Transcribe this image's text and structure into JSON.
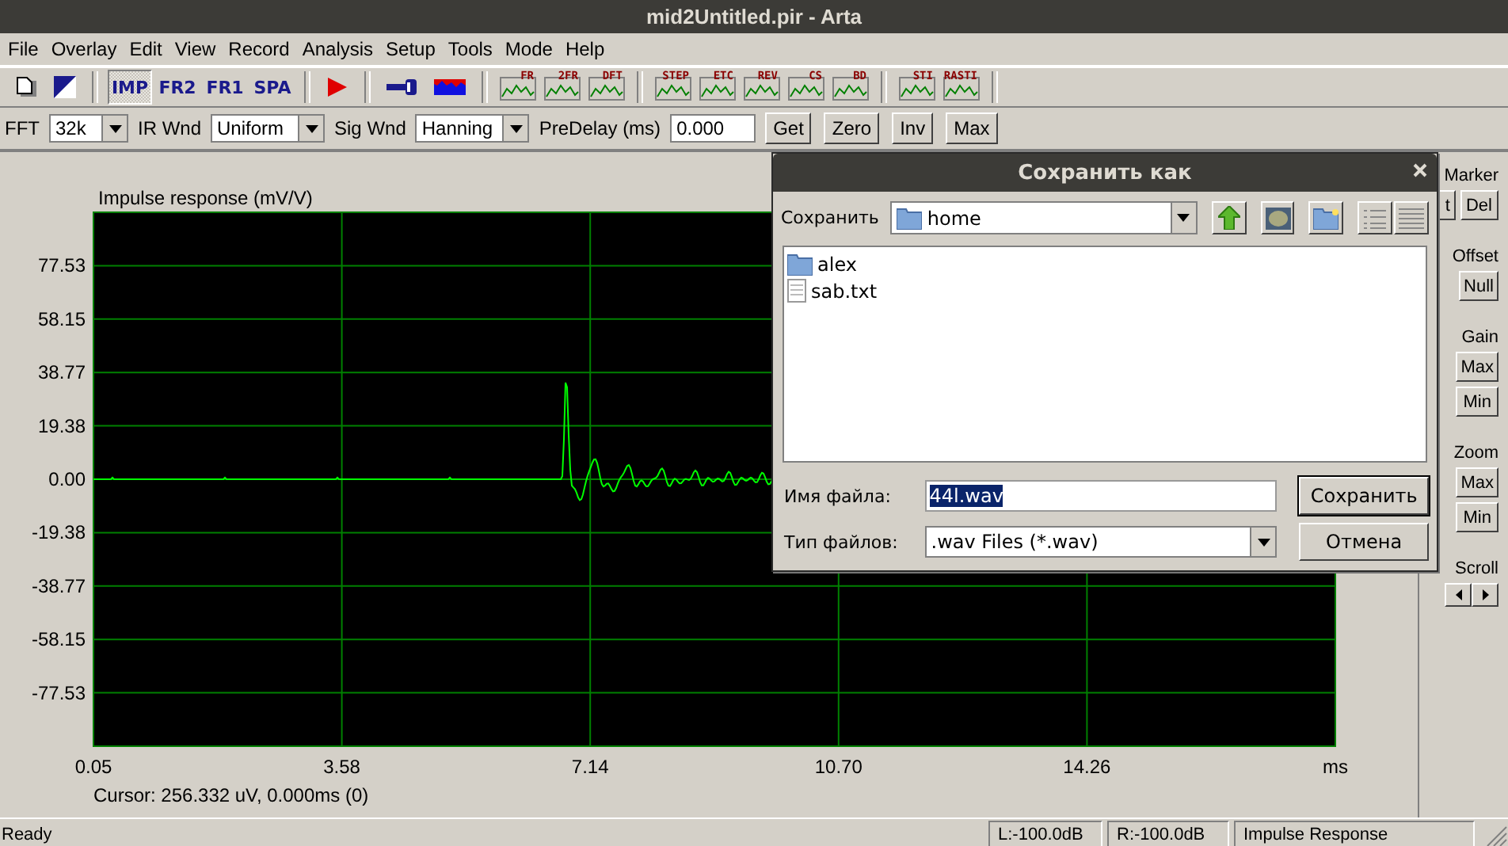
{
  "window": {
    "title": "mid2Untitled.pir - Arta"
  },
  "menu": [
    "File",
    "Overlay",
    "Edit",
    "View",
    "Record",
    "Analysis",
    "Setup",
    "Tools",
    "Mode",
    "Help"
  ],
  "toolbar": [
    {
      "kind": "icon"
    },
    {
      "kind": "icon"
    },
    {
      "kind": "sep"
    },
    {
      "kind": "mode",
      "label": "IMP",
      "selected": true
    },
    {
      "kind": "mode",
      "label": "FR2",
      "selected": false
    },
    {
      "kind": "mode",
      "label": "FR1",
      "selected": false
    },
    {
      "kind": "mode",
      "label": "SPA",
      "selected": false
    },
    {
      "kind": "sep"
    },
    {
      "kind": "icon"
    },
    {
      "kind": "sep"
    },
    {
      "kind": "icon"
    },
    {
      "kind": "icon"
    },
    {
      "kind": "sep"
    },
    {
      "kind": "graph",
      "label": "FR"
    },
    {
      "kind": "graph",
      "label": "2FR"
    },
    {
      "kind": "graph",
      "label": "DFT"
    },
    {
      "kind": "sep"
    },
    {
      "kind": "graph",
      "label": "STEP"
    },
    {
      "kind": "graph",
      "label": "ETC"
    },
    {
      "kind": "graph",
      "label": "REV"
    },
    {
      "kind": "graph",
      "label": "CS"
    },
    {
      "kind": "graph",
      "label": "BD"
    },
    {
      "kind": "sep"
    },
    {
      "kind": "graph",
      "label": "STI"
    },
    {
      "kind": "graph",
      "label": "RASTI"
    },
    {
      "kind": "sep"
    }
  ],
  "params": [
    {
      "kind": "combo",
      "label": "FFT",
      "value": "32k"
    },
    {
      "kind": "combo",
      "label": "IR Wnd",
      "value": "Uniform"
    },
    {
      "kind": "combo",
      "label": "Sig Wnd",
      "value": "Hanning"
    },
    {
      "kind": "field",
      "label": "PreDelay (ms)",
      "value": "0.000"
    }
  ],
  "param_buttons": [
    "Get",
    "Zero",
    "Inv",
    "Max"
  ],
  "plot": {
    "title": "Impulse response (mV/V)",
    "y_ticks": [
      "77.53",
      "58.15",
      "38.77",
      "19.38",
      "0.00",
      "-19.38",
      "-38.77",
      "-58.15",
      "-77.53"
    ],
    "x_ticks": [
      "0.05",
      "3.58",
      "7.14",
      "10.70",
      "14.26"
    ],
    "x_unit": "ms",
    "cursor": "Cursor: 256.332 uV, 0.000ms (0)"
  },
  "side_panel": [
    {
      "title": "Marker",
      "kind": "row",
      "buttons": [
        "t",
        "Del"
      ]
    },
    {
      "title": "Offset",
      "kind": "column",
      "buttons": [
        "Null"
      ]
    },
    {
      "title": "Gain",
      "kind": "column",
      "buttons": [
        "Max",
        "Min"
      ]
    },
    {
      "title": "Zoom",
      "kind": "column",
      "buttons": [
        "Max",
        "Min"
      ]
    },
    {
      "title": "Scroll",
      "kind": "arrows"
    }
  ],
  "dialog": {
    "title": "Сохранить как",
    "location_label": "Сохранить",
    "location": "home",
    "files": [
      {
        "kind": "folder",
        "name": "alex"
      },
      {
        "kind": "file",
        "name": "sab.txt"
      }
    ],
    "filename_label": "Имя файла:",
    "filename": "44l.wav",
    "filename_selected": true,
    "type_label": "Тип файлов:",
    "type": ".wav Files (*.wav)",
    "buttons": [
      {
        "label": "Сохранить",
        "default": true
      },
      {
        "label": "Отмена",
        "default": false
      }
    ]
  },
  "status_bar": {
    "message": "Ready",
    "panels": [
      "L:-100.0dB",
      "R:-100.0dB",
      "Impulse Response"
    ]
  }
}
